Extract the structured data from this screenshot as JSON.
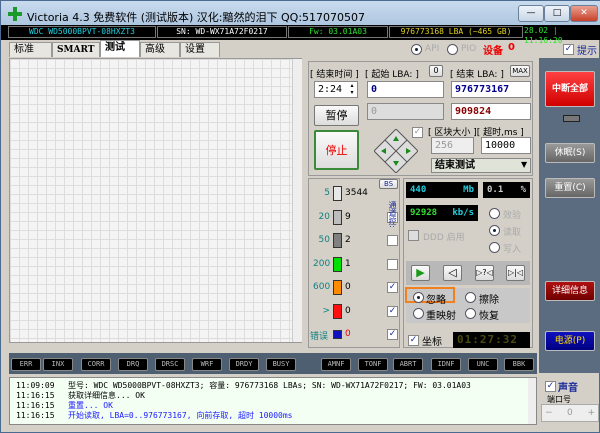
{
  "window": {
    "title": "Victoria 4.3 免费软件 (测试版本) 汉化:黯然的泪下 QQ:517070507",
    "minimize": "—",
    "maximize": "□",
    "close": "✕"
  },
  "infobar": {
    "model": "WDC WD5000BPVT-08HXZT3",
    "serial": "SN: WD-WX71A72F0217",
    "firmware": "Fw: 03.01A03",
    "capacity": "976773168 LBA (~465 GB)",
    "clock": "28.02 | 11:16:20"
  },
  "tabs": [
    "标准",
    "SMART",
    "测试",
    "高级",
    "设置"
  ],
  "active_tab": "测试",
  "mode": {
    "api": "API",
    "pio": "PIO",
    "device_label": "设备",
    "device_value": "0",
    "hint": "提示"
  },
  "test": {
    "end_time_label": "[ 结束时间 ]",
    "time": "2:24",
    "start_lba_label": "[ 起始 LBA: ]",
    "start_zero": "0",
    "end_lba_label": "[ 结束 LBA: ]",
    "max": "MAX",
    "start_lba": "0",
    "end_lba": "976773167",
    "current": "0",
    "current_end": "909824",
    "pause": "暂停",
    "stop": "停止",
    "block_label": "[ 区块大小 ][ 超时,ms ]",
    "block_size": "256",
    "timeout": "10000",
    "end_action": "结束测试"
  },
  "blocks": [
    {
      "label": "5",
      "count": "3544",
      "color": "#e8e8e8"
    },
    {
      "label": "20",
      "count": "9",
      "color": "#bdbdbd"
    },
    {
      "label": "50",
      "count": "2",
      "color": "#808080"
    },
    {
      "label": "200",
      "count": "1",
      "color": "#00e000"
    },
    {
      "label": "600",
      "count": "0",
      "color": "#ff8c00"
    },
    {
      "label": ">",
      "count": "0",
      "color": "#ff1010"
    },
    {
      "label": "错误",
      "count": "0",
      "color": "#1010c0"
    }
  ],
  "bs": "BS",
  "vertical_label": "通道控:",
  "stats": {
    "mb": "440",
    "mb_unit": "Mb",
    "percent": "0.1",
    "percent_unit": "%",
    "speed": "92928",
    "speed_unit": "kb/s",
    "ddd": "DDD 启用",
    "verify": "效验",
    "read": "读取",
    "write": "写入"
  },
  "actions": {
    "ignore": "忽略",
    "erase": "擦除",
    "remap": "重映射",
    "restore": "恢复",
    "coords": "坐标",
    "timer": "01:27:32"
  },
  "right": {
    "abort_all": "中断全部",
    "sleep": "休眠(S)",
    "reset": "重置(C)",
    "details": "详细信息",
    "power": "电源(P)",
    "sound": "声音",
    "port_label": "端口号",
    "port": "0",
    "minus": "−",
    "plus": "+"
  },
  "leds": [
    "ERR",
    "INX",
    "CORR",
    "DRQ",
    "DRSC",
    "WRF",
    "DRDY",
    "BUSY",
    "AMNF",
    "TONF",
    "ABRT",
    "IDNF",
    "UNC",
    "BBK"
  ],
  "log": [
    {
      "time": "11:09:09",
      "text": "型号: WDC WD5000BPVT-08HXZT3;     容量: 976773168 LBAs; SN: WD-WX71A72F0217; FW: 03.01A03",
      "color": "#000"
    },
    {
      "time": "11:16:15",
      "text": "获取详细信息... OK",
      "color": "#000"
    },
    {
      "time": "11:16:15",
      "text": "重置... OK",
      "color": "#1a1aff"
    },
    {
      "time": "11:16:15",
      "text": "开始读取, LBA=0..976773167, 向前存取, 超时 10000ms",
      "color": "#1a1aff"
    }
  ]
}
